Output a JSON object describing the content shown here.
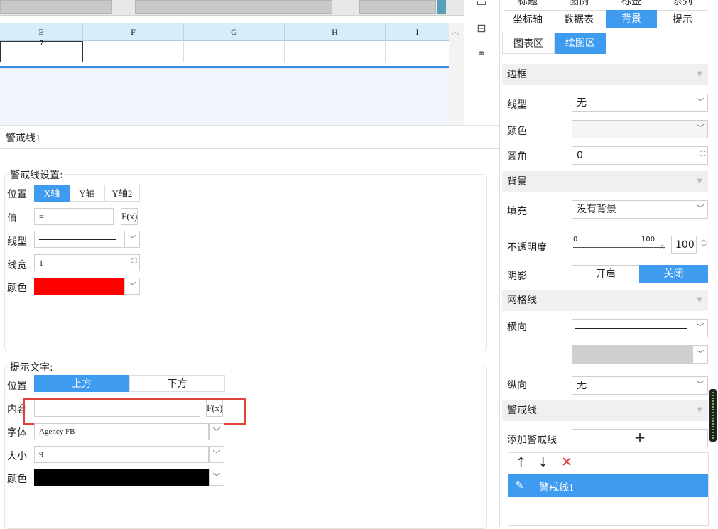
{
  "spreadsheet": {
    "columns": [
      "E",
      "F",
      "G",
      "H",
      "I"
    ],
    "cell_e_partial": "7"
  },
  "left_panel": {
    "tab_title": "警戒线1",
    "warning_settings": {
      "legend": "警戒线设置:",
      "position_label": "位置",
      "position_options": [
        "X轴",
        "Y轴",
        "Y轴2"
      ],
      "value_label": "值",
      "value": "=",
      "fx_label": "F(x)",
      "line_type_label": "线型",
      "line_width_label": "线宽",
      "line_width_value": "1",
      "color_label": "颜色",
      "color_value": "#ff0000"
    },
    "hint_text": {
      "legend": "提示文字:",
      "position_label": "位置",
      "position_options": [
        "上方",
        "下方"
      ],
      "content_label": "内容",
      "content_value": "",
      "fx_label": "F(x)",
      "font_label": "字体",
      "font_value": "Agency FB",
      "size_label": "大小",
      "size_value": "9",
      "color_label": "颜色",
      "color_value": "#000000"
    }
  },
  "right_panel": {
    "top_tabs_row1": [
      "标题",
      "图例",
      "标签",
      "系列"
    ],
    "top_tabs_row2": [
      "坐标轴",
      "数据表",
      "背景",
      "提示"
    ],
    "sub_tabs": [
      "图表区",
      "绘图区"
    ],
    "border_section": "边框",
    "line_type_label": "线型",
    "line_type_value": "无",
    "color_label": "颜色",
    "radius_label": "圆角",
    "radius_value": "0",
    "background_section": "背景",
    "fill_label": "填充",
    "fill_value": "没有背景",
    "opacity_label": "不透明度",
    "opacity_min": "0",
    "opacity_max": "100",
    "opacity_value": "100",
    "shadow_label": "阴影",
    "shadow_on": "开启",
    "shadow_off": "关闭",
    "gridline_section": "网格线",
    "horizontal_label": "横向",
    "vertical_label": "纵向",
    "vertical_value": "无",
    "warning_section": "警戒线",
    "add_warning_label": "添加警戒线",
    "add_symbol": "+",
    "list_items": [
      "警戒线1"
    ],
    "accent_color": "#3f9bf0"
  }
}
